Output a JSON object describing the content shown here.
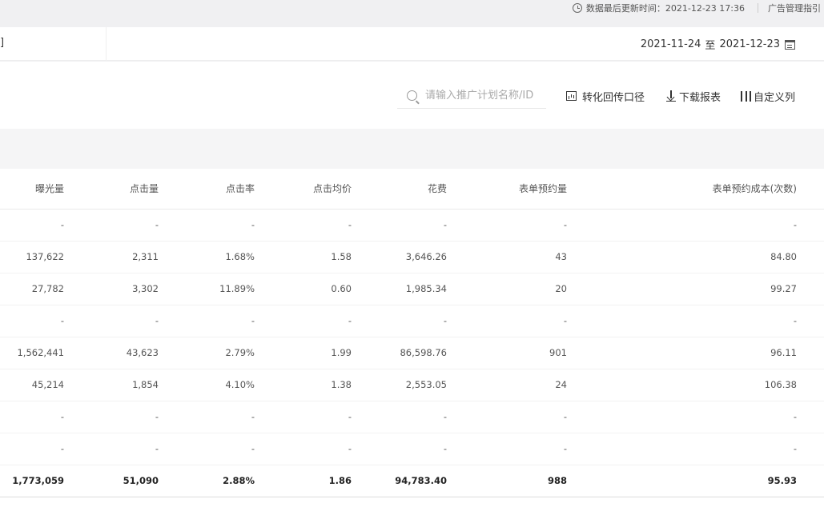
{
  "topbar": {
    "update_label": "数据最后更新时间：2021-12-23 17:36",
    "guide_label": "广告管理指引"
  },
  "datebar": {
    "tab_fragment": "]",
    "date_from": "2021-11-24",
    "to_label": "至",
    "date_to": "2021-12-23"
  },
  "toolbar": {
    "search_placeholder": "请输入推广计划名称/ID",
    "convert_label": "转化回传口径",
    "download_label": "下载报表",
    "columns_label": "自定义列"
  },
  "table": {
    "headers": [
      "曝光量",
      "点击量",
      "点击率",
      "点击均价",
      "花费",
      "表单预约量",
      "表单预约成本(次数)"
    ],
    "rows": [
      [
        "-",
        "-",
        "-",
        "-",
        "-",
        "-",
        "-"
      ],
      [
        "137,622",
        "2,311",
        "1.68%",
        "1.58",
        "3,646.26",
        "43",
        "84.80"
      ],
      [
        "27,782",
        "3,302",
        "11.89%",
        "0.60",
        "1,985.34",
        "20",
        "99.27"
      ],
      [
        "-",
        "-",
        "-",
        "-",
        "-",
        "-",
        "-"
      ],
      [
        "1,562,441",
        "43,623",
        "2.79%",
        "1.99",
        "86,598.76",
        "901",
        "96.11"
      ],
      [
        "45,214",
        "1,854",
        "4.10%",
        "1.38",
        "2,553.05",
        "24",
        "106.38"
      ],
      [
        "-",
        "-",
        "-",
        "-",
        "-",
        "-",
        "-"
      ],
      [
        "-",
        "-",
        "-",
        "-",
        "-",
        "-",
        "-"
      ]
    ],
    "total": [
      "1,773,059",
      "51,090",
      "2.88%",
      "1.86",
      "94,783.40",
      "988",
      "95.93"
    ]
  }
}
